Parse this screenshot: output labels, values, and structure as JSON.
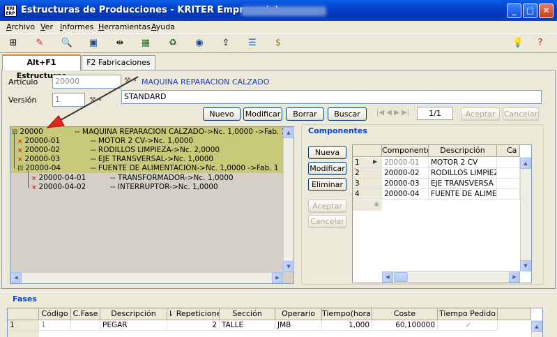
{
  "window": {
    "title": "Estructuras de Producciones - KRITER Empresarial",
    "icon_text_top": "KRI",
    "icon_text_bottom": "ERP",
    "min": "_",
    "max": "□",
    "close": "✕"
  },
  "menu": [
    "Archivo",
    "Ver",
    "Informes",
    "Herramientas",
    "Ayuda"
  ],
  "toolbar": [
    "tree-icon",
    "pencil-icon",
    "preview-icon",
    "view-icon",
    "swap-icon",
    "calculator-icon",
    "recycle-icon",
    "globe-icon",
    "export-icon",
    "hierarchy-icon",
    "money-bag-icon",
    "lightbulb-icon",
    "help-icon"
  ],
  "tabs": {
    "structures": "Alt+F1 Estructuras",
    "fabrications": "F2 Fabricaciones"
  },
  "form": {
    "article_label": "Artículo",
    "article_value": "20000",
    "article_name": "MAQUINA REPARACION CALZADO",
    "version_label": "Versión",
    "version_value": "1",
    "version_name": "STANDARD",
    "lookup": "⚒→"
  },
  "actions": {
    "new": "Nuevo",
    "modify": "Modificar",
    "delete": "Borrar",
    "search": "Buscar",
    "accept": "Aceptar",
    "cancel": "Cancelar",
    "record": "1/1",
    "nav": "|◀ ◀ ▶ ▶|"
  },
  "tree": [
    {
      "code": "20000",
      "desc": "-- MAQUINA REPARACION CALZADO->Nc. 1,0000 ->Fab. 1",
      "mark": "⊟"
    },
    {
      "code": "20000-01",
      "desc": "-- MOTOR 2 CV->Nc. 1,0000",
      "mark": "×"
    },
    {
      "code": "20000-02",
      "desc": "-- RODILLOS LIMPIEZA->Nc. 2,0000",
      "mark": "×"
    },
    {
      "code": "20000-03",
      "desc": "-- EJE TRANSVERSAL->Nc. 1,0000",
      "mark": "×"
    },
    {
      "code": "20000-04",
      "desc": "-- FUENTE DE ALIMENTACION->Nc. 1,0000 ->Fab. 1",
      "mark": "⊟"
    },
    {
      "code": "20000-04-01",
      "desc": "-- TRANSFORMADOR->Nc. 1,0000",
      "mark": "×"
    },
    {
      "code": "20000-04-02",
      "desc": "-- INTERRUPTOR->Nc. 1,0000",
      "mark": "×"
    }
  ],
  "components": {
    "title": "Componentes",
    "buttons": {
      "new": "Nueva",
      "modify": "Modificar",
      "delete": "Eliminar",
      "accept": "Aceptar",
      "cancel": "Cancelar"
    },
    "headers": [
      "Componente",
      "Descripción",
      "Ca"
    ],
    "rows": [
      {
        "n": "1",
        "code": "20000-01",
        "desc": "MOTOR 2 CV"
      },
      {
        "n": "2",
        "code": "20000-02",
        "desc": "RODILLOS LIMPIEZ"
      },
      {
        "n": "3",
        "code": "20000-03",
        "desc": "EJE TRANSVERSA"
      },
      {
        "n": "4",
        "code": "20000-04",
        "desc": "FUENTE DE ALIME"
      }
    ],
    "new_row_marker": "⁜"
  },
  "phases": {
    "title": "Fases",
    "headers": [
      "Código",
      "C.Fase",
      "Descripción",
      "⇂ Repeticione",
      "Sección",
      "Operario",
      "Tiempo(hora)",
      "Coste",
      "Tiempo Pedido"
    ],
    "rows": [
      {
        "n": "1",
        "code": "1",
        "cfase": "",
        "desc": "PEGAR",
        "rep": "2",
        "section": "TALLE",
        "operator": "JMB",
        "time": "1,000",
        "cost": "60,100000",
        "ordered": "✓"
      }
    ]
  }
}
